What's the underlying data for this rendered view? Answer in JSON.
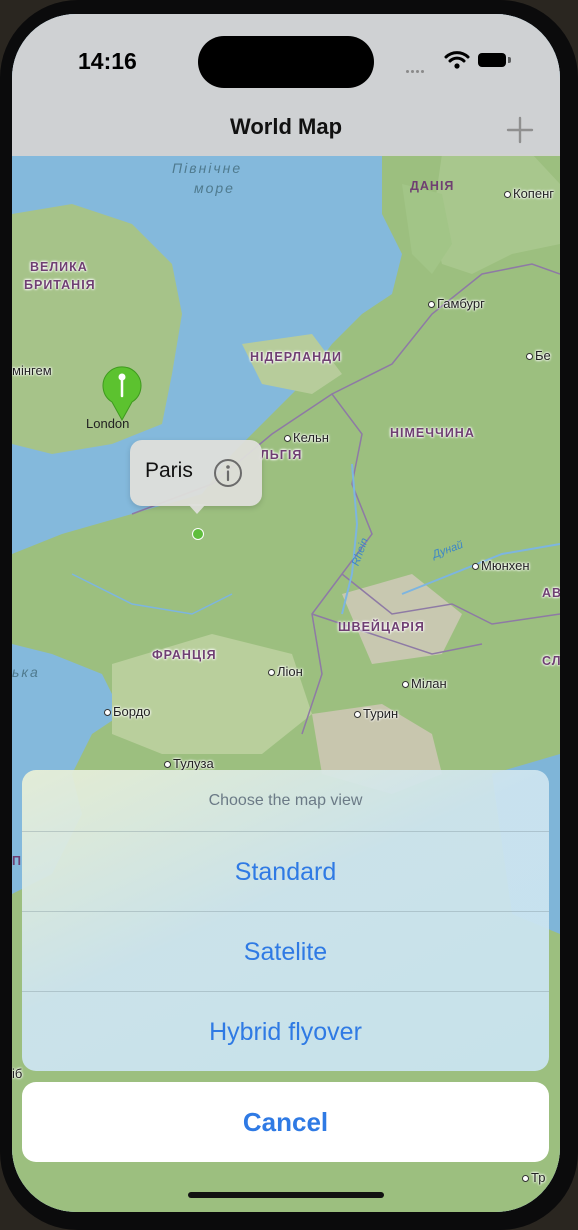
{
  "status_bar": {
    "time": "14:16"
  },
  "navigation": {
    "title": "World Map",
    "add_label": "+"
  },
  "map": {
    "labels": {
      "north_sea_1": "Північне",
      "north_sea_2": "море",
      "denmark": "ДАНІЯ",
      "copenhagen": "Копенг",
      "great_britain_1": "ВЕЛИКА",
      "great_britain_2": "БРИТАНІЯ",
      "hamburg": "Гамбург",
      "netherlands": "НІДЕРЛАНДИ",
      "berlin": "Бе",
      "birmingham": "мінгем",
      "london": "London",
      "cologne": "Кельн",
      "germany": "НІМЕЧЧИНА",
      "belgium": "ЛЬГІЯ",
      "rhein": "Rhein",
      "danube": "Дунай",
      "munich": "Мюнхен",
      "austria": "АВ",
      "switzerland": "ШВЕЙЦАРІЯ",
      "france": "ФРАНЦІЯ",
      "slovenia": "СЛ",
      "lyon": "Ліон",
      "milan": "Мілан",
      "biscay": "ька",
      "bordeaux": "Бордо",
      "turin": "Турин",
      "toulouse": "Тулуза",
      "left_letter": "П",
      "edge_bottom": "іб",
      "trieste": "Тр"
    },
    "pins": [
      {
        "name": "London",
        "color": "#5cc22f"
      }
    ],
    "callout": {
      "title": "Paris",
      "icon": "info-icon"
    }
  },
  "action_sheet": {
    "title": "Choose the map view",
    "options": [
      "Standard",
      "Satelite",
      "Hybrid flyover"
    ],
    "cancel": "Cancel"
  },
  "colors": {
    "accent": "#2f7ae4",
    "pin": "#5cc22f"
  }
}
